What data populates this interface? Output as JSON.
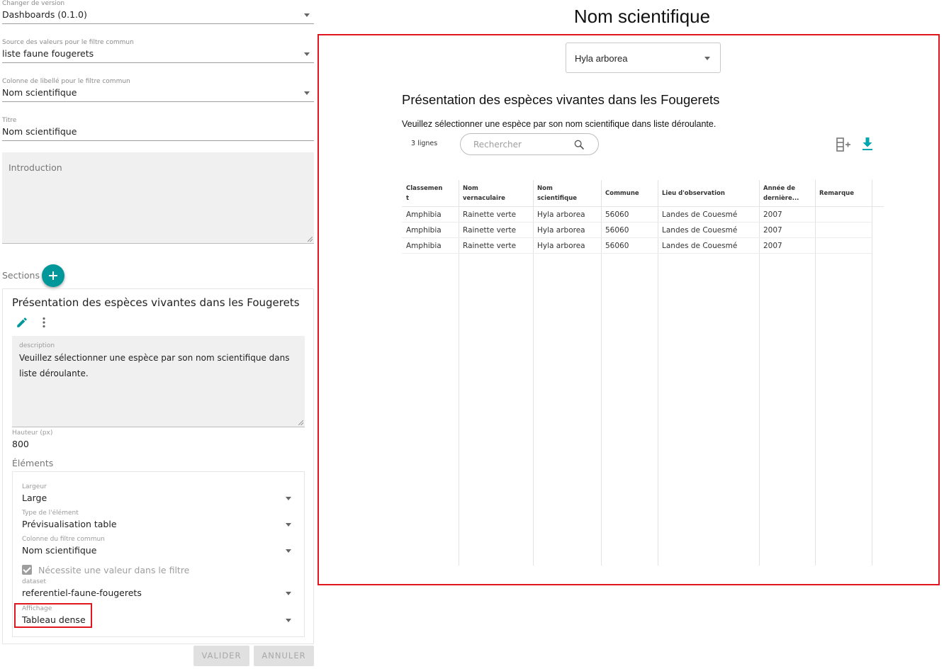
{
  "editor": {
    "version": {
      "label": "Changer de version",
      "value": "Dashboards (0.1.0)"
    },
    "filter_source": {
      "label": "Source des valeurs pour le filtre commun",
      "value": "liste faune fougerets"
    },
    "filter_label_column": {
      "label": "Colonne de libellé pour le filtre commun",
      "value": "Nom scientifique"
    },
    "title": {
      "label": "Titre",
      "value": "Nom scientifique"
    },
    "introduction": {
      "placeholder": "Introduction",
      "value": ""
    },
    "sections_label": "Sections",
    "section": {
      "title": "Présentation des espèces vivantes dans les Fougerets",
      "description": {
        "label": "description",
        "value": "Veuillez sélectionner une espèce par son nom scientifique dans liste déroulante."
      },
      "height": {
        "label": "Hauteur (px)",
        "value": "800"
      },
      "elements_label": "Éléments",
      "element": {
        "width": {
          "label": "Largeur",
          "value": "Large"
        },
        "type": {
          "label": "Type de l'élément",
          "value": "Prévisualisation table"
        },
        "filter_column": {
          "label": "Colonne du filtre commun",
          "value": "Nom scientifique"
        },
        "requires_value": {
          "label": "Nécessite une valeur dans le filtre",
          "checked": true
        },
        "dataset": {
          "label": "dataset",
          "value": "referentiel-faune-fougerets"
        },
        "display": {
          "label": "Affichage",
          "value": "Tableau dense"
        }
      }
    },
    "buttons": {
      "validate": "VALIDER",
      "cancel": "ANNULER"
    }
  },
  "preview": {
    "page_title": "Nom scientifique",
    "filter_value": "Hyla arborea",
    "section_title": "Présentation des espèces vivantes dans les Fougerets",
    "section_description": "Veuillez sélectionner une espèce par son nom scientifique dans liste déroulante.",
    "rows_count": "3 lignes",
    "search_placeholder": "Rechercher",
    "icons": {
      "search": "search-icon",
      "columns": "add-column-icon",
      "download": "download-icon"
    },
    "accent_color": "#00979a",
    "highlight_color": "#e0161f",
    "table": {
      "headers": [
        "Classement",
        "Nom vernaculaire",
        "Nom scientifique",
        "Commune",
        "Lieu d'observation",
        "Année de dernière...",
        "Remarque"
      ],
      "header_display": [
        "Classemen\nt",
        "Nom\nvernaculaire",
        "Nom\nscientifique",
        "Commune",
        "Lieu d'observation",
        "Année de\ndernière...",
        "Remarque"
      ],
      "rows": [
        [
          "Amphibia",
          "Rainette verte",
          "Hyla arborea",
          "56060",
          "Landes de Couesmé",
          "2007",
          ""
        ],
        [
          "Amphibia",
          "Rainette verte",
          "Hyla arborea",
          "56060",
          "Landes de Couesmé",
          "2007",
          ""
        ],
        [
          "Amphibia",
          "Rainette verte",
          "Hyla arborea",
          "56060",
          "Landes de Couesmé",
          "2007",
          ""
        ]
      ]
    }
  }
}
